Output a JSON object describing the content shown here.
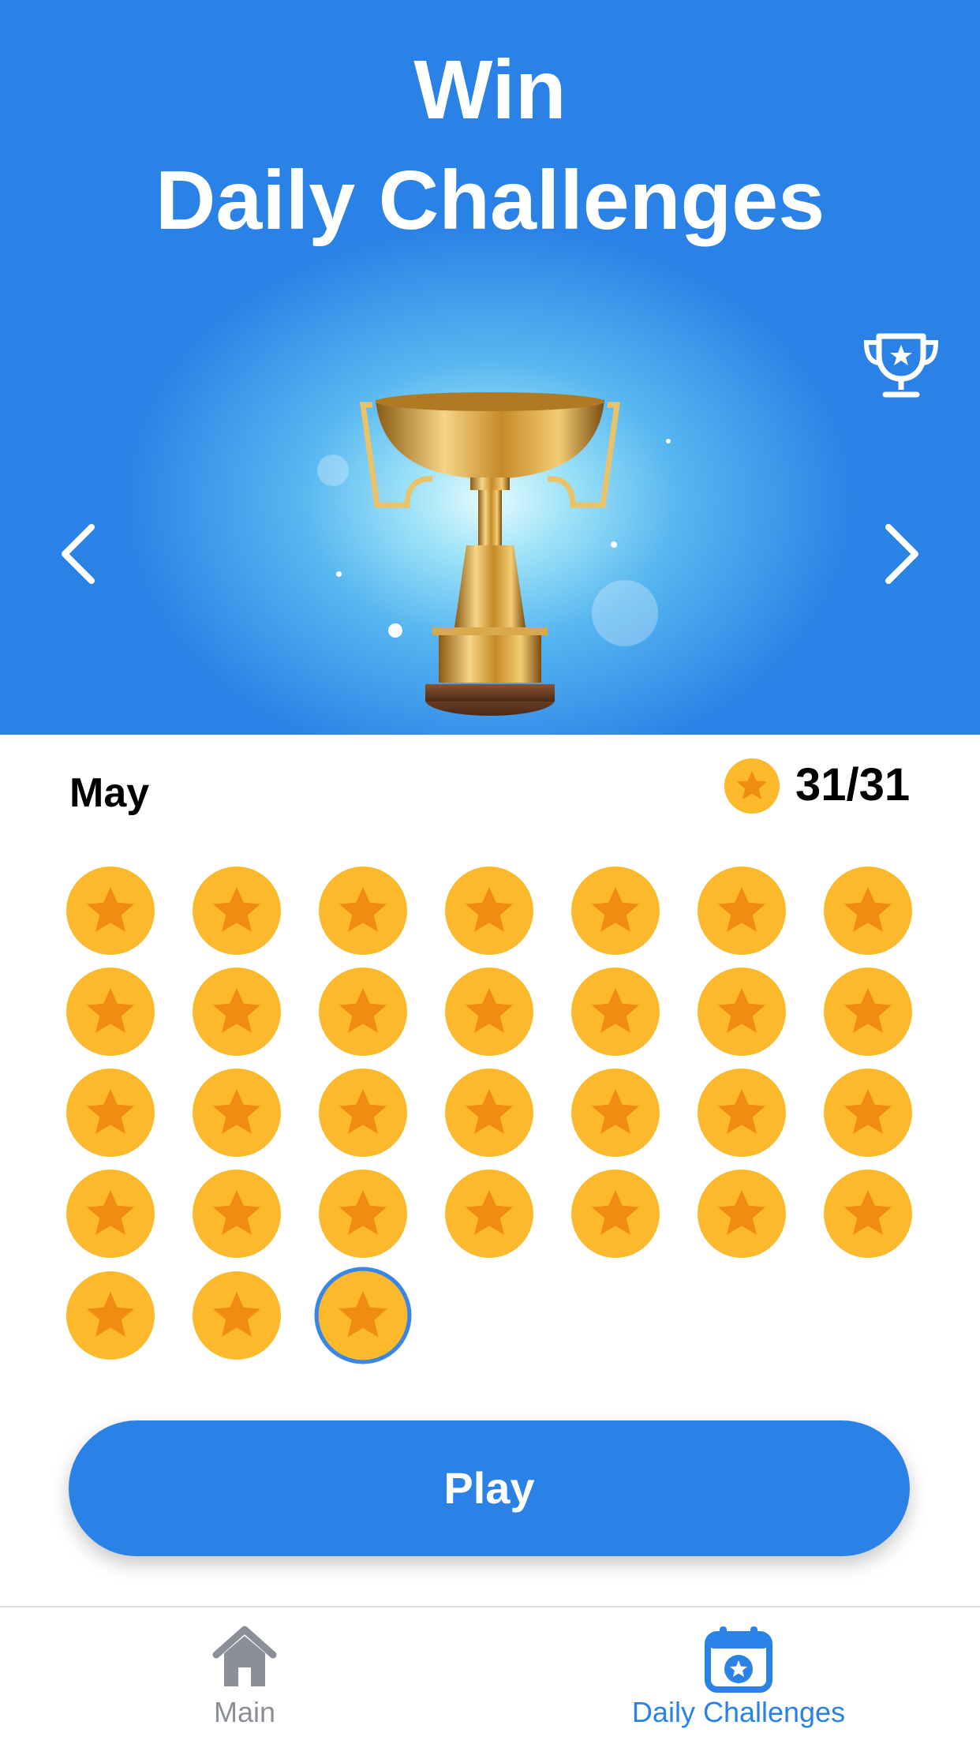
{
  "hero": {
    "title_line1": "Win",
    "title_line2": "Daily Challenges",
    "background_color": "#2a82e6",
    "image": "golden-trophy"
  },
  "calendar": {
    "month": "May",
    "progress_text": "31/31",
    "completed_days": 31,
    "total_days": 31,
    "current_day": 31,
    "coin_color": "#fbb92b",
    "star_color": "#f08c12",
    "selected_ring_color": "#3a86e8"
  },
  "play_button": {
    "label": "Play"
  },
  "tabbar": {
    "items": [
      {
        "label": "Main",
        "icon": "home-icon",
        "active": false
      },
      {
        "label": "Daily Challenges",
        "icon": "calendar-star-icon",
        "active": true
      }
    ]
  }
}
